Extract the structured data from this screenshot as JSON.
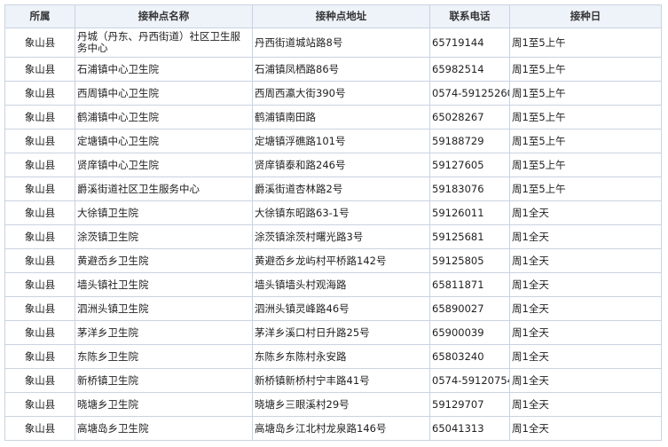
{
  "table": {
    "headers": [
      "所属",
      "接种点名称",
      "接种点地址",
      "联系电话",
      "接种日"
    ],
    "rows": [
      [
        "象山县",
        "丹城（丹东、丹西街道）社区卫生服务中心",
        "丹西街道城站路8号",
        "65719144",
        "周1至5上午"
      ],
      [
        "象山县",
        "石浦镇中心卫生院",
        "石浦镇凤栖路86号",
        "65982514",
        "周1至5上午"
      ],
      [
        "象山县",
        "西周镇中心卫生院",
        "西周西瀛大街390号",
        "0574-59125260",
        "周1至5上午"
      ],
      [
        "象山县",
        "鹤浦镇中心卫生院",
        "鹤浦镇南田路",
        "65028267",
        "周1至5上午"
      ],
      [
        "象山县",
        "定塘镇中心卫生院",
        "定塘镇浮礁路101号",
        "59188729",
        "周1至5上午"
      ],
      [
        "象山县",
        "贤庠镇中心卫生院",
        "贤庠镇泰和路246号",
        "59127605",
        "周1至5上午"
      ],
      [
        "象山县",
        "爵溪街道社区卫生服务中心",
        "爵溪街道杏林路2号",
        "59183076",
        "周1至5上午"
      ],
      [
        "象山县",
        "大徐镇卫生院",
        "大徐镇东昭路63-1号",
        "59126011",
        "周1全天"
      ],
      [
        "象山县",
        "涂茨镇卫生院",
        "涂茨镇涂茨村曙光路3号",
        "59125681",
        "周1全天"
      ],
      [
        "象山县",
        "黄避岙乡卫生院",
        "黄避岙乡龙屿村平桥路142号",
        "59125805",
        "周1全天"
      ],
      [
        "象山县",
        "墙头镇社卫生院",
        "墙头镇墙头村观海路",
        "65811871",
        "周1全天"
      ],
      [
        "象山县",
        "泗洲头镇卫生院",
        "泗洲头镇灵峰路46号",
        "65890027",
        "周1全天"
      ],
      [
        "象山县",
        "茅洋乡卫生院",
        "茅洋乡溪口村日升路25号",
        "65900039",
        "周1全天"
      ],
      [
        "象山县",
        "东陈乡卫生院",
        "东陈乡东陈村永安路",
        "65803240",
        "周1全天"
      ],
      [
        "象山县",
        "新桥镇卫生院",
        "新桥镇新桥村宁丰路41号",
        "0574-59120754",
        "周1全天"
      ],
      [
        "象山县",
        "晓塘乡卫生院",
        "晓塘乡三眼溪村29号",
        "59129707",
        "周1全天"
      ],
      [
        "象山县",
        "高塘岛乡卫生院",
        "高塘岛乡江北村龙泉路146号",
        "65041313",
        "周1全天"
      ]
    ]
  }
}
